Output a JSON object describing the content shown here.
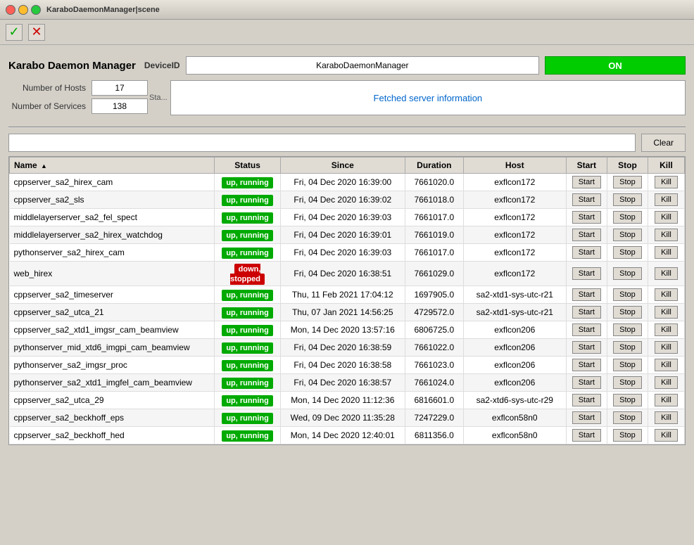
{
  "window": {
    "title": "KaraboDaemonManager|scene"
  },
  "toolbar": {
    "check_icon": "✓",
    "x_icon": "✕"
  },
  "header": {
    "app_title": "Karabo Daemon Manager",
    "device_id_label": "DeviceID",
    "device_id_value": "KaraboDaemonManager",
    "on_button_label": "ON",
    "num_hosts_label": "Number of Hosts",
    "num_hosts_value": "17",
    "num_services_label": "Number of Services",
    "num_services_value": "138",
    "sta_label": "Sta...",
    "status_text": "Fetched server information"
  },
  "filter": {
    "placeholder": "",
    "clear_label": "Clear"
  },
  "table": {
    "columns": [
      "Name",
      "Status",
      "Since",
      "Duration",
      "Host",
      "Start",
      "Stop",
      "Kill"
    ],
    "rows": [
      {
        "name": "cppserver_sa2_hirex_cam",
        "status": "up, running",
        "status_type": "running",
        "since": "Fri, 04 Dec 2020 16:39:00",
        "duration": "7661020.0",
        "host": "exflcon172"
      },
      {
        "name": "cppserver_sa2_sls",
        "status": "up, running",
        "status_type": "running",
        "since": "Fri, 04 Dec 2020 16:39:02",
        "duration": "7661018.0",
        "host": "exflcon172"
      },
      {
        "name": "middlelayerserver_sa2_fel_spect",
        "status": "up, running",
        "status_type": "running",
        "since": "Fri, 04 Dec 2020 16:39:03",
        "duration": "7661017.0",
        "host": "exflcon172"
      },
      {
        "name": "middlelayerserver_sa2_hirex_watchdog",
        "status": "up, running",
        "status_type": "running",
        "since": "Fri, 04 Dec 2020 16:39:01",
        "duration": "7661019.0",
        "host": "exflcon172"
      },
      {
        "name": "pythonserver_sa2_hirex_cam",
        "status": "up, running",
        "status_type": "running",
        "since": "Fri, 04 Dec 2020 16:39:03",
        "duration": "7661017.0",
        "host": "exflcon172"
      },
      {
        "name": "web_hirex",
        "status": "down, stopped",
        "status_type": "stopped",
        "since": "Fri, 04 Dec 2020 16:38:51",
        "duration": "7661029.0",
        "host": "exflcon172"
      },
      {
        "name": "cppserver_sa2_timeserver",
        "status": "up, running",
        "status_type": "running",
        "since": "Thu, 11 Feb 2021 17:04:12",
        "duration": "1697905.0",
        "host": "sa2-xtd1-sys-utc-r21"
      },
      {
        "name": "cppserver_sa2_utca_21",
        "status": "up, running",
        "status_type": "running",
        "since": "Thu, 07 Jan 2021 14:56:25",
        "duration": "4729572.0",
        "host": "sa2-xtd1-sys-utc-r21"
      },
      {
        "name": "cppserver_sa2_xtd1_imgsr_cam_beamview",
        "status": "up, running",
        "status_type": "running",
        "since": "Mon, 14 Dec 2020 13:57:16",
        "duration": "6806725.0",
        "host": "exflcon206"
      },
      {
        "name": "pythonserver_mid_xtd6_imgpi_cam_beamview",
        "status": "up, running",
        "status_type": "running",
        "since": "Fri, 04 Dec 2020 16:38:59",
        "duration": "7661022.0",
        "host": "exflcon206"
      },
      {
        "name": "pythonserver_sa2_imgsr_proc",
        "status": "up, running",
        "status_type": "running",
        "since": "Fri, 04 Dec 2020 16:38:58",
        "duration": "7661023.0",
        "host": "exflcon206"
      },
      {
        "name": "pythonserver_sa2_xtd1_imgfel_cam_beamview",
        "status": "up, running",
        "status_type": "running",
        "since": "Fri, 04 Dec 2020 16:38:57",
        "duration": "7661024.0",
        "host": "exflcon206"
      },
      {
        "name": "cppserver_sa2_utca_29",
        "status": "up, running",
        "status_type": "running",
        "since": "Mon, 14 Dec 2020 11:12:36",
        "duration": "6816601.0",
        "host": "sa2-xtd6-sys-utc-r29"
      },
      {
        "name": "cppserver_sa2_beckhoff_eps",
        "status": "up, running",
        "status_type": "running",
        "since": "Wed, 09 Dec 2020 11:35:28",
        "duration": "7247229.0",
        "host": "exflcon58n0"
      },
      {
        "name": "cppserver_sa2_beckhoff_hed",
        "status": "up, running",
        "status_type": "running",
        "since": "Mon, 14 Dec 2020 12:40:01",
        "duration": "6811356.0",
        "host": "exflcon58n0"
      }
    ],
    "start_label": "Start",
    "stop_label": "Stop",
    "kill_label": "Kill"
  }
}
